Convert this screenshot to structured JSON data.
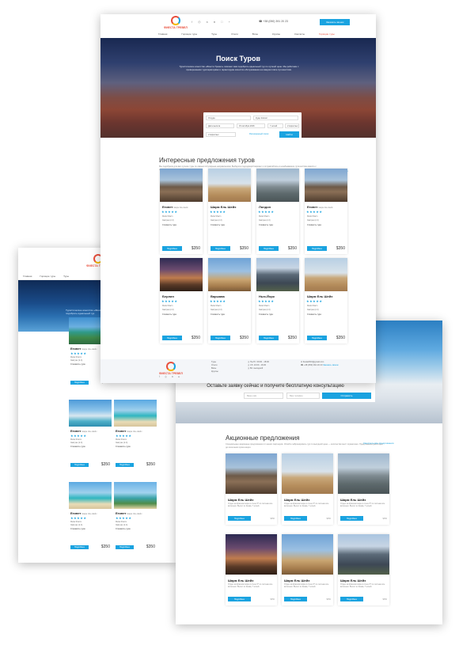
{
  "brand": {
    "logo_text": "ФИЕСТА ТРЕВЕЛ",
    "accent": "#1aa3e0",
    "hot": "#e94f3c"
  },
  "main": {
    "phone": "+38 (050) 391 20 23",
    "cta": "Заказать звонок",
    "nav": [
      "Главная",
      "Горящие туры",
      "Туры",
      "Отели",
      "Визы",
      "Круизы",
      "Контакты",
      "Горящие туры"
    ],
    "hero": {
      "title": "Поиск Туров",
      "subtitle": "Туристическое агентство «Фиеста Тревел» поможет вам подобрать идеальный тур по лучшей цене. Мы работаем с проверенными туроператорами и гарантируем качество обслуживания на каждом этапе путешествия."
    },
    "search": {
      "from": "Откуда",
      "to": "Куда: Египет",
      "date_from": "Дата вылета",
      "date_to": "15 октября 2016",
      "nights": "7 ночей",
      "tourists": "2 взрослых",
      "extra": "Расширенный поиск",
      "submit": "Найти"
    },
    "section_title": "Интересные предложения туров",
    "section_text": "Мы подобрали для вас лучшие туры по самым популярным направлениям. Выберите подходящий вариант и отправляйтесь в незабываемое путешествие вместе с нами. Горящие туры обновляются ежедневно.",
    "section_link": "Смотреть все предложения",
    "cards": [
      {
        "title": "Египет",
        "sub": "Шарм Эль Шейх",
        "stars": "★★★★★",
        "hotel": "Melia Sharm",
        "meal": "Завтрак (2-3)",
        "price_label": "Стоимость тура:",
        "button": "Подробнее",
        "price": "$350"
      },
      {
        "title": "Шарм Ель Шейх",
        "sub": "",
        "stars": "★★★★★",
        "hotel": "Melia Sharm",
        "meal": "Завтрак (2-3)",
        "price_label": "Стоимость тура:",
        "button": "Подробнее",
        "price": "$350"
      },
      {
        "title": "Лондон",
        "sub": "",
        "stars": "★★★★★",
        "hotel": "Melia Sharm",
        "meal": "Завтрак (2-3)",
        "price_label": "Стоимость тура:",
        "button": "Подробнее",
        "price": "$350"
      },
      {
        "title": "Египет",
        "sub": "Шарм Эль Шейх",
        "stars": "★★★★★",
        "hotel": "Melia Sharm",
        "meal": "Завтрак (2-3)",
        "price_label": "Стоимость тура:",
        "button": "Подробнее",
        "price": "$350"
      },
      {
        "title": "Берлин",
        "sub": "",
        "stars": "★★★★★",
        "hotel": "Melia Sharm",
        "meal": "Завтрак (2-3)",
        "price_label": "Стоимость тура:",
        "button": "Подробнее",
        "price": "$350"
      },
      {
        "title": "Варшава",
        "sub": "",
        "stars": "★★★★★",
        "hotel": "Melia Sharm",
        "meal": "Завтрак (2-3)",
        "price_label": "Стоимость тура:",
        "button": "Подробнее",
        "price": "$350"
      },
      {
        "title": "Нью-Йорк",
        "sub": "",
        "stars": "★★★★★",
        "hotel": "Melia Sharm",
        "meal": "Завтрак (2-3)",
        "price_label": "Стоимость тура:",
        "button": "Подробнее",
        "price": "$350"
      },
      {
        "title": "Шарм Ель Шейх",
        "sub": "",
        "stars": "★★★★★",
        "hotel": "Melia Sharm",
        "meal": "Завтрак (2-3)",
        "price_label": "Стоимость тура:",
        "button": "Подробнее",
        "price": "$350"
      }
    ],
    "footer": {
      "links": [
        "Туры",
        "Отели",
        "Визы",
        "Круизы"
      ],
      "hours1": "Пн-Пт: 09:00 - 18:00",
      "hours2": "Сб: 10:00 - 16:00",
      "hours3": "Вс: выходной",
      "email": "fiesta2016@gmail.com",
      "phone": "+38 (050) 391 20 23",
      "callback": "Заказать звонок"
    }
  },
  "consult": {
    "title": "Оставьте заявку сейчас и получите бесплатную консультацию",
    "name_placeholder": "Ваше имя",
    "phone_placeholder": "Ваш телефон",
    "submit": "Отправить"
  },
  "left": {
    "nav": [
      "Главная",
      "Горящие туры",
      "Туры"
    ],
    "hero_text": "Туристическое агентство «Фиеста Тревел» поможет вам подобрать идеальный тур",
    "cards": [
      {
        "title": "Египет",
        "sub": "Шарм Эль Шейх",
        "stars": "★★★★★",
        "row": "Melia Sharm",
        "row2": "Завтрак (2-3)",
        "price_label": "Стоимость тура:",
        "button": "Подробнее",
        "price": "$350"
      },
      {
        "title": "Египет",
        "sub": "Шарм Эль Шейх",
        "stars": "★★★★★",
        "row": "Melia Sharm",
        "row2": "Завтрак (2-3)",
        "price_label": "Стоимость тура:",
        "button": "Подробнее",
        "price": "$350"
      },
      {
        "title": "Египет",
        "sub": "Шарм Эль Шейх",
        "stars": "★★★★★",
        "row": "Melia Sharm",
        "row2": "Завтрак (2-3)",
        "price_label": "Стоимость тура:",
        "button": "Подробнее",
        "price": "$350"
      },
      {
        "title": "Египет",
        "sub": "Шарм Эль Шейх",
        "stars": "★★★★★",
        "row": "Melia Sharm",
        "row2": "Завтрак (2-3)",
        "price_label": "Стоимость тура:",
        "button": "Подробнее",
        "price": "$350"
      },
      {
        "title": "Египет",
        "sub": "Шарм Эль Шейх",
        "stars": "★★★★★",
        "row": "Melia Sharm",
        "row2": "Завтрак (2-3)",
        "price_label": "Стоимость тура:",
        "button": "Подробнее",
        "price": "$350"
      }
    ]
  },
  "right": {
    "section_title": "Акционные предложения",
    "section_text": "Специальные акционные предложения от наших партнеров. Успейте забронировать тур по выгодной цене — количество мест ограничено. Предложения действуют до окончания срока акции.",
    "section_link": "Смотреть все предложения",
    "cards": [
      {
        "title": "Шарм Ель Шейх",
        "desc": "Отдых на Красном море в отеле 5* по системе все включено. Вылет из Киева, 7 ночей.",
        "button": "Подробнее",
        "price": "$350"
      },
      {
        "title": "Шарм Ель Шейх",
        "desc": "Отдых на Красном море в отеле 5* по системе все включено. Вылет из Киева, 7 ночей.",
        "button": "Подробнее",
        "price": "$350"
      },
      {
        "title": "Шарм Ель Шейх",
        "desc": "Отдых на Красном море в отеле 5* по системе все включено. Вылет из Киева, 7 ночей.",
        "button": "Подробнее",
        "price": "$350"
      },
      {
        "title": "Шарм Ель Шейх",
        "desc": "Отдых на Красном море в отеле 5* по системе все включено. Вылет из Киева, 7 ночей.",
        "button": "Подробнее",
        "price": "$350"
      },
      {
        "title": "Шарм Ель Шейх",
        "desc": "Отдых на Красном море в отеле 5* по системе все включено. Вылет из Киева, 7 ночей.",
        "button": "Подробнее",
        "price": "$350"
      },
      {
        "title": "Шарм Ель Шейх",
        "desc": "Отдых на Красном море в отеле 5* по системе все включено. Вылет из Киева, 7 ночей.",
        "button": "Подробнее",
        "price": "$350"
      }
    ]
  }
}
